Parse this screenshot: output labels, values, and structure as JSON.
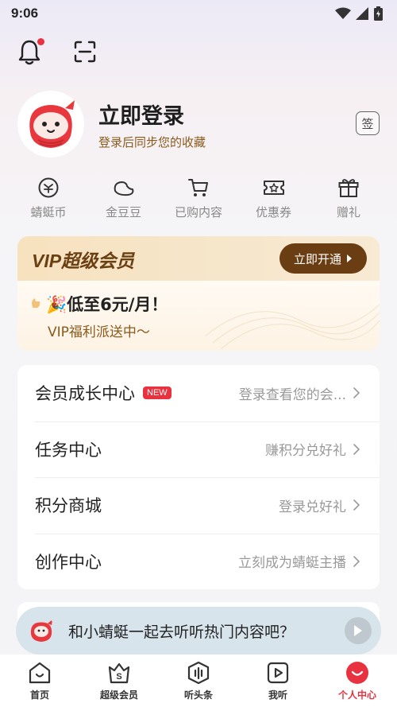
{
  "status": {
    "time": "9:06"
  },
  "profile": {
    "title": "立即登录",
    "subtitle": "登录后同步您的收藏",
    "signin_label": "签"
  },
  "quick": [
    {
      "label": "蜻蜓币",
      "icon": "coin-icon"
    },
    {
      "label": "金豆豆",
      "icon": "bean-icon"
    },
    {
      "label": "已购内容",
      "icon": "cart-icon"
    },
    {
      "label": "优惠券",
      "icon": "coupon-icon"
    },
    {
      "label": "赠礼",
      "icon": "gift-icon"
    }
  ],
  "vip": {
    "title": "VIP超级会员",
    "open_label": "立即开通",
    "offer": "🎉低至6元/月！",
    "offer_sub": "VIP福利派送中～"
  },
  "menu": [
    {
      "label": "会员成长中心",
      "badge": "NEW",
      "value": "登录查看您的会..."
    },
    {
      "label": "任务中心",
      "value": "赚积分兑好礼"
    },
    {
      "label": "积分商城",
      "value": "登录兑好礼"
    },
    {
      "label": "创作中心",
      "value": "立刻成为蜻蜓主播"
    }
  ],
  "mini_player": {
    "text": "和小蜻蜓一起去听听热门内容吧？"
  },
  "tabs": [
    {
      "label": "首页"
    },
    {
      "label": "超级会员"
    },
    {
      "label": "听头条"
    },
    {
      "label": "我听"
    },
    {
      "label": "个人中心"
    }
  ],
  "colors": {
    "accent": "#e8323f",
    "vip_brown": "#6b3d12",
    "gold_text": "#8a5a1c"
  }
}
